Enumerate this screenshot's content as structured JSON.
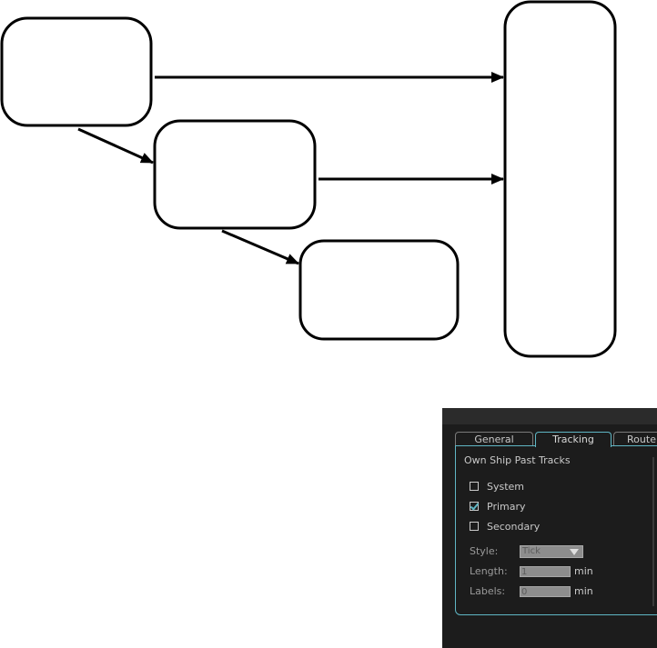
{
  "diagram": {
    "nodes": [
      {
        "id": "box-a",
        "label": ""
      },
      {
        "id": "box-b",
        "label": ""
      },
      {
        "id": "box-c",
        "label": ""
      },
      {
        "id": "box-tall",
        "label": ""
      }
    ],
    "edges": [
      {
        "from": "box-a",
        "to": "box-tall"
      },
      {
        "from": "box-a",
        "to": "box-b"
      },
      {
        "from": "box-b",
        "to": "box-tall"
      },
      {
        "from": "box-b",
        "to": "box-c"
      }
    ]
  },
  "panel": {
    "tabs": [
      {
        "label": "General",
        "active": false
      },
      {
        "label": "Tracking",
        "active": true
      },
      {
        "label": "Route",
        "active": false
      }
    ],
    "section_title": "Own Ship Past Tracks",
    "checkboxes": [
      {
        "label": "System",
        "checked": false
      },
      {
        "label": "Primary",
        "checked": true
      },
      {
        "label": "Secondary",
        "checked": false
      }
    ],
    "fields": {
      "style_label": "Style:",
      "style_value": "Tick",
      "length_label": "Length:",
      "length_value": "1",
      "length_unit": "min",
      "labels_label": "Labels:",
      "labels_value": "0",
      "labels_unit": "min"
    },
    "colors": {
      "accent": "#5fb6c4",
      "background": "#1c1c1c"
    }
  }
}
